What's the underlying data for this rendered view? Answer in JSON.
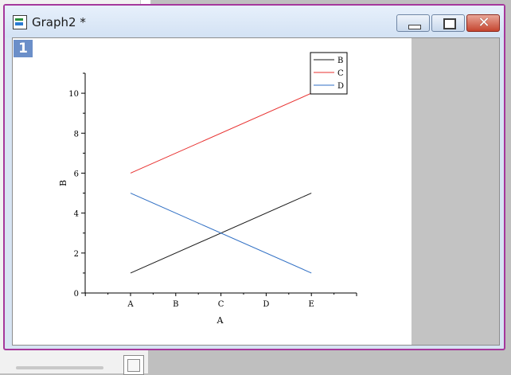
{
  "window": {
    "title": "Graph2 *",
    "layer_badge": "1",
    "buttons": {
      "minimize": "minimize",
      "maximize": "maximize",
      "close": "close"
    }
  },
  "colors": {
    "window_border": "#a5389c",
    "series_B": "#1a1a1a",
    "series_C": "#e8302f",
    "series_D": "#2f6fc4"
  },
  "chart_data": {
    "type": "line",
    "categories": [
      "A",
      "B",
      "C",
      "D",
      "E"
    ],
    "xlabel": "A",
    "ylabel": "B",
    "ylim": [
      0,
      11
    ],
    "yticks": [
      0,
      2,
      4,
      6,
      8,
      10
    ],
    "grid": false,
    "legend_position": "top-right",
    "series": [
      {
        "name": "B",
        "color": "#1a1a1a",
        "points": [
          {
            "x": "A",
            "y": 1
          },
          {
            "x": "E",
            "y": 5
          }
        ]
      },
      {
        "name": "C",
        "color": "#e8302f",
        "points": [
          {
            "x": "A",
            "y": 6
          },
          {
            "x": "E",
            "y": 10
          }
        ]
      },
      {
        "name": "D",
        "color": "#2f6fc4",
        "points": [
          {
            "x": "A",
            "y": 5
          },
          {
            "x": "E",
            "y": 1
          }
        ]
      }
    ]
  }
}
